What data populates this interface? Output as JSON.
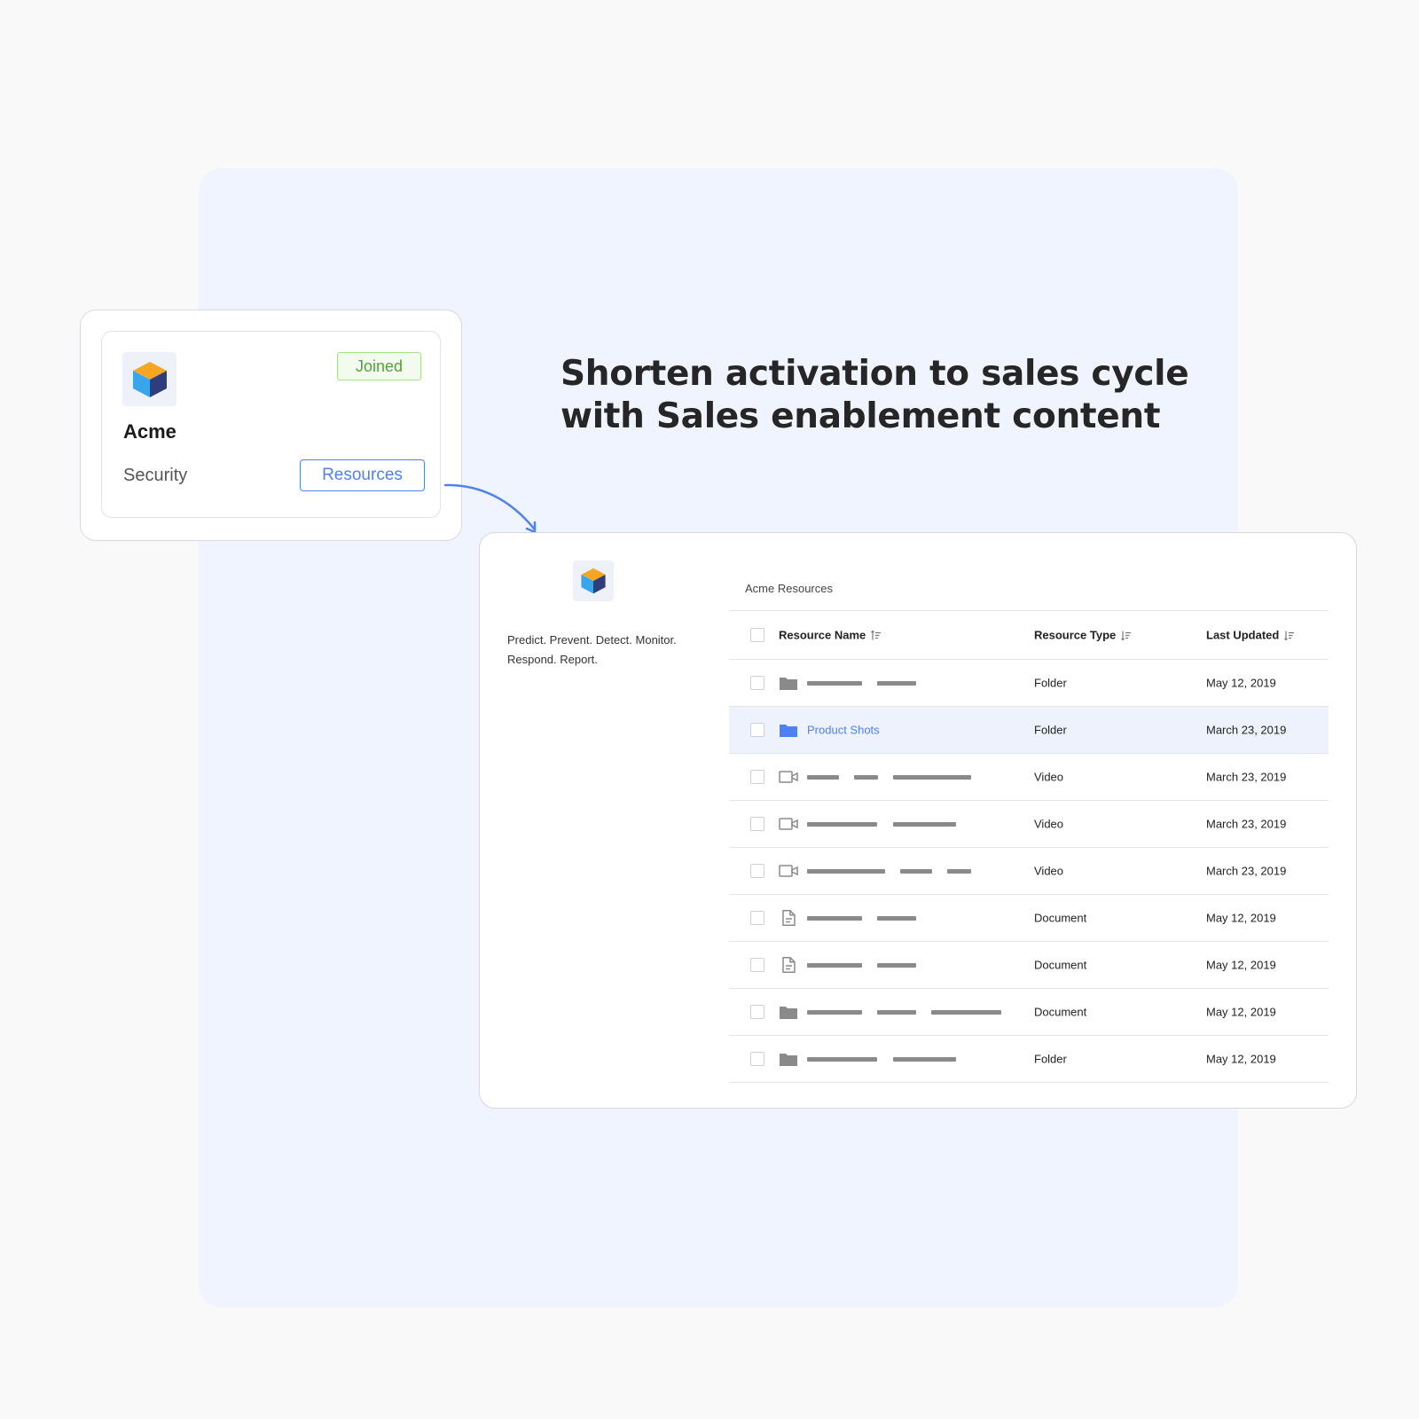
{
  "headline": {
    "line1": "Shorten activation to sales cycle",
    "line2": "with Sales enablement content"
  },
  "company_card": {
    "status_badge": "Joined",
    "name": "Acme",
    "category": "Security",
    "resources_button": "Resources"
  },
  "panel": {
    "tagline_line1": "Predict. Prevent. Detect. Monitor.",
    "tagline_line2": "Respond. Report.",
    "title": "Acme Resources",
    "columns": {
      "name": "Resource Name",
      "type": "Resource Type",
      "updated": "Last Updated"
    },
    "rows": [
      {
        "icon": "folder-icon",
        "name": "",
        "type": "Folder",
        "updated": "May 12, 2019"
      },
      {
        "icon": "folder-icon",
        "name": "Product Shots",
        "type": "Folder",
        "updated": "March 23, 2019"
      },
      {
        "icon": "video-icon",
        "name": "",
        "type": "Video",
        "updated": "March 23, 2019"
      },
      {
        "icon": "video-icon",
        "name": "",
        "type": "Video",
        "updated": "March 23, 2019"
      },
      {
        "icon": "video-icon",
        "name": "",
        "type": "Video",
        "updated": "March 23, 2019"
      },
      {
        "icon": "document-icon",
        "name": "",
        "type": "Document",
        "updated": "May 12, 2019"
      },
      {
        "icon": "document-icon",
        "name": "",
        "type": "Document",
        "updated": "May 12, 2019"
      },
      {
        "icon": "folder-icon",
        "name": "",
        "type": "Document",
        "updated": "May 12, 2019"
      },
      {
        "icon": "folder-icon",
        "name": "",
        "type": "Folder",
        "updated": "May 12, 2019"
      }
    ]
  },
  "colors": {
    "accent": "#4e82f0",
    "joined_green": "#52a336",
    "backdrop": "#eff4fe",
    "highlight_row": "#edf2fd"
  }
}
